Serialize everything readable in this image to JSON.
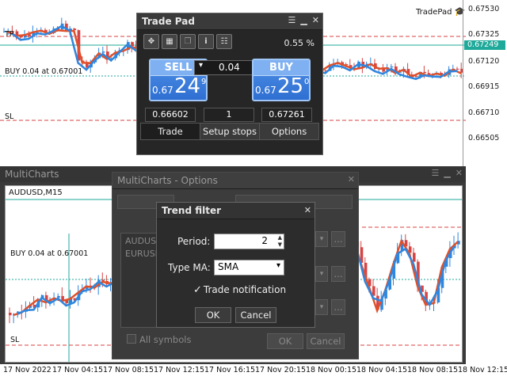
{
  "top_chart": {
    "symbol_badge": "TradePad",
    "prices": [
      "0.67530",
      "0.67325",
      "0.67249",
      "0.67120",
      "0.66915",
      "0.66710",
      "0.66505"
    ],
    "current_price": "0.67249",
    "tp_label": "TP",
    "buy_line_label": "BUY 0.04 at 0.67001",
    "sl_label": "SL"
  },
  "trade_pad": {
    "title": "Trade Pad",
    "percent": "0.55 %",
    "sell": {
      "label": "SELL",
      "prefix": "0.67",
      "big": "24",
      "sup": "9"
    },
    "buy": {
      "label": "BUY",
      "prefix": "0.67",
      "big": "25",
      "sup": "0"
    },
    "volume": "0.04",
    "sl_value": "0.66602",
    "lots_value": "1",
    "tp_value": "0.67261",
    "tabs": [
      "Trade",
      "Setup stops",
      "Options"
    ]
  },
  "multicharts": {
    "title": "MultiCharts",
    "symbol_label": "AUDUSD,M15",
    "buy_line_label": "BUY 0.04 at 0.67001",
    "sl_label": "SL",
    "time_labels": [
      "17 Nov 2022",
      "17 Nov 04:15",
      "17 Nov 08:15",
      "17 Nov 12:15",
      "17 Nov 16:15",
      "17 Nov 20:15",
      "18 Nov 00:15",
      "18 Nov 04:15",
      "18 Nov 08:15",
      "18 Nov 12:15"
    ]
  },
  "options_dialog": {
    "title": "MultiCharts - Options",
    "symbols": [
      "AUDUSD",
      "EURUSD"
    ],
    "all_symbols_label": "All symbols",
    "ok_label": "OK",
    "cancel_label": "Cancel",
    "ellipsis": "..."
  },
  "trend_filter": {
    "title": "Trend filter",
    "period_label": "Period:",
    "period_value": "2",
    "type_ma_label": "Type MA:",
    "type_ma_value": "SMA",
    "notification_label": "Trade notification",
    "notification_checked": true,
    "ok_label": "OK",
    "cancel_label": "Cancel"
  },
  "colors": {
    "accent_teal": "#1fa99a",
    "bull_red": "#e0502a",
    "bear_blue": "#2e86de",
    "button_blue": "#3a7fe0"
  }
}
